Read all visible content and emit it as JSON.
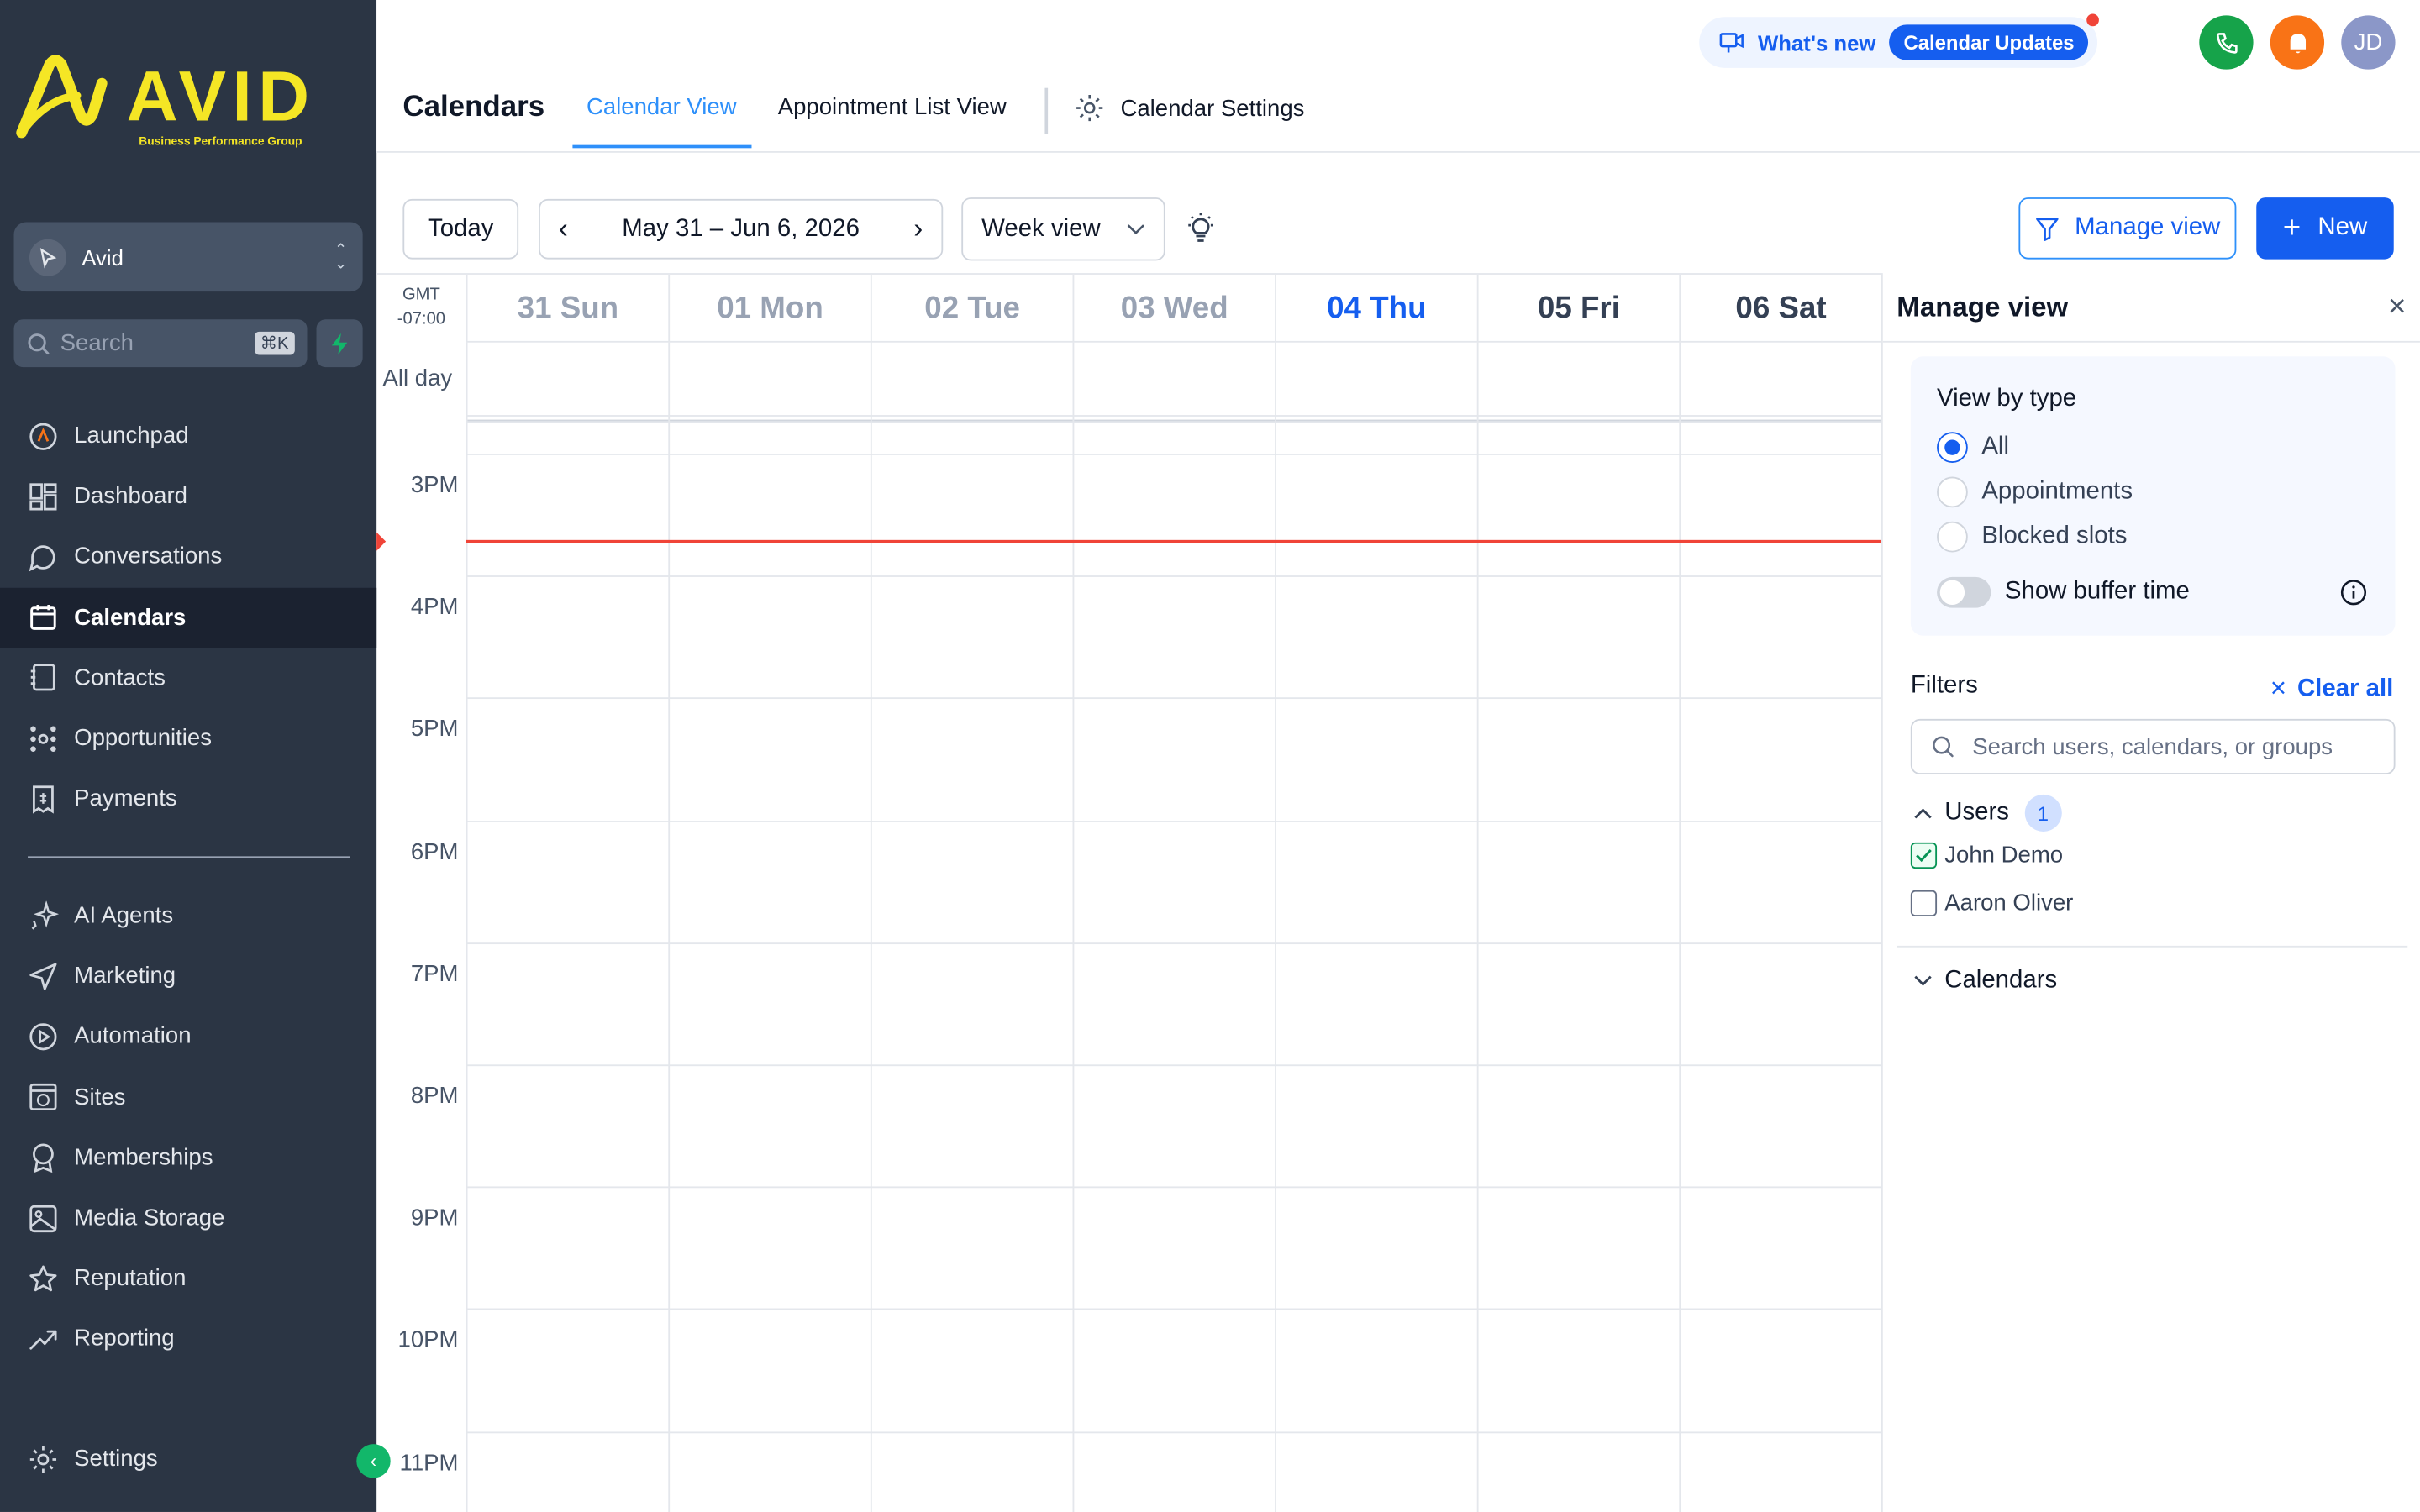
{
  "brand": {
    "name": "AVID",
    "tagline": "Business Performance Group",
    "accent": "#f5e625"
  },
  "sidebar": {
    "location": "Avid",
    "search_placeholder": "Search",
    "search_shortcut": "⌘K",
    "items_top": [
      {
        "label": "Launchpad",
        "icon": "launchpad-icon"
      },
      {
        "label": "Dashboard",
        "icon": "dashboard-icon"
      },
      {
        "label": "Conversations",
        "icon": "conversations-icon"
      },
      {
        "label": "Calendars",
        "icon": "calendar-icon",
        "active": true
      },
      {
        "label": "Contacts",
        "icon": "contacts-icon"
      },
      {
        "label": "Opportunities",
        "icon": "opportunities-icon"
      },
      {
        "label": "Payments",
        "icon": "payments-icon"
      }
    ],
    "items_bottom": [
      {
        "label": "AI Agents",
        "icon": "sparkle-icon"
      },
      {
        "label": "Marketing",
        "icon": "send-icon"
      },
      {
        "label": "Automation",
        "icon": "automation-icon"
      },
      {
        "label": "Sites",
        "icon": "globe-icon"
      },
      {
        "label": "Memberships",
        "icon": "award-icon"
      },
      {
        "label": "Media Storage",
        "icon": "image-icon"
      },
      {
        "label": "Reputation",
        "icon": "star-icon"
      },
      {
        "label": "Reporting",
        "icon": "trending-icon"
      }
    ],
    "settings_label": "Settings"
  },
  "header": {
    "title": "Calendars",
    "tabs": [
      "Calendar View",
      "Appointment List View",
      "Calendar Settings"
    ],
    "whats_new": "What's new",
    "updates_pill": "Calendar Updates",
    "avatar_initials": "JD"
  },
  "toolbar": {
    "today": "Today",
    "date_range": "May 31 – Jun 6, 2026",
    "view_select": "Week view",
    "manage_view": "Manage view",
    "new": "New"
  },
  "calendar": {
    "timezone_line1": "GMT",
    "timezone_line2": "-07:00",
    "all_day": "All day",
    "days": [
      "31 Sun",
      "01 Mon",
      "02 Tue",
      "03 Wed",
      "04 Thu",
      "05 Fri",
      "06 Sat"
    ],
    "today_index": 4,
    "hours": [
      "3PM",
      "4PM",
      "5PM",
      "6PM",
      "7PM",
      "8PM",
      "9PM",
      "10PM",
      "11PM"
    ]
  },
  "manage_view": {
    "title": "Manage view",
    "view_by_type_title": "View by type",
    "types": [
      "All",
      "Appointments",
      "Blocked slots"
    ],
    "selected_type": "All",
    "buffer_label": "Show buffer time",
    "buffer_on": false,
    "filters_title": "Filters",
    "clear_all": "Clear all",
    "filter_placeholder": "Search users, calendars, or groups",
    "users_label": "Users",
    "users_count": "1",
    "users": [
      {
        "name": "John Demo",
        "checked": true
      },
      {
        "name": "Aaron Oliver",
        "checked": false
      }
    ],
    "calendars_label": "Calendars"
  },
  "colors": {
    "sidebar_bg": "#2b3544",
    "primary": "#155eef",
    "now_line": "#f04438",
    "phone_btn": "#16a34a",
    "bell_btn": "#f97316",
    "avatar_bg": "#8b97c8"
  }
}
